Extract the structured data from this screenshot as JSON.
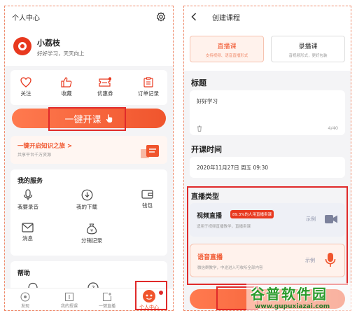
{
  "left": {
    "title": "个人中心",
    "user_name": "小荔枝",
    "user_motto": "好好学习，天天向上",
    "quick_actions": [
      {
        "label": "关注",
        "icon": "heart-icon"
      },
      {
        "label": "收藏",
        "icon": "thumbs-up-icon"
      },
      {
        "label": "优惠券",
        "icon": "coupon-icon"
      },
      {
        "label": "订单记录",
        "icon": "order-icon"
      }
    ],
    "cta_label": "一键开课",
    "banner_title": "一键开启知识之旅 >",
    "banner_sub": "共享平台千万资源",
    "services_title": "我的服务",
    "services": [
      {
        "label": "我要录音",
        "icon": "microphone-icon"
      },
      {
        "label": "我的下载",
        "icon": "download-icon"
      },
      {
        "label": "钱包",
        "icon": "wallet-icon"
      },
      {
        "label": "消息",
        "icon": "mail-icon"
      },
      {
        "label": "分销记录",
        "icon": "money-bag-icon"
      }
    ],
    "help_title": "帮助",
    "tabs": [
      {
        "label": "发现",
        "icon": "discover-icon"
      },
      {
        "label": "我的授课",
        "icon": "course-icon"
      },
      {
        "label": "一键直播",
        "icon": "live-add-icon"
      },
      {
        "label": "个人中心",
        "icon": "profile-icon"
      }
    ]
  },
  "right": {
    "title": "创建课程",
    "type_live": "直播课",
    "type_live_sub": "支持视频、语音直播形式",
    "type_record": "录播课",
    "type_record_sub": "音视频形式，更好包装",
    "field_title_label": "标题",
    "field_title_value": "好好学习",
    "field_title_counter": "4/40",
    "field_time_label": "开课时间",
    "field_time_value": "2020年11月27日 周五 09:30",
    "live_type_label": "直播类型",
    "video_live_title": "视频直播",
    "video_live_badge": "89.3%的人用直播卖课",
    "video_live_desc": "适用于视频直播教学，直播卖课",
    "video_live_example": "示例",
    "voice_live_title": "语音直播",
    "voice_live_desc": "微信群教学，中途进入可收听全部内容",
    "voice_live_example": "示例"
  },
  "watermark": {
    "brand": "谷普软件园",
    "url": "www.gupuxiazai.com"
  },
  "colors": {
    "accent": "#f0552d",
    "highlight": "#e02a2a",
    "background": "#f4f4f6"
  }
}
